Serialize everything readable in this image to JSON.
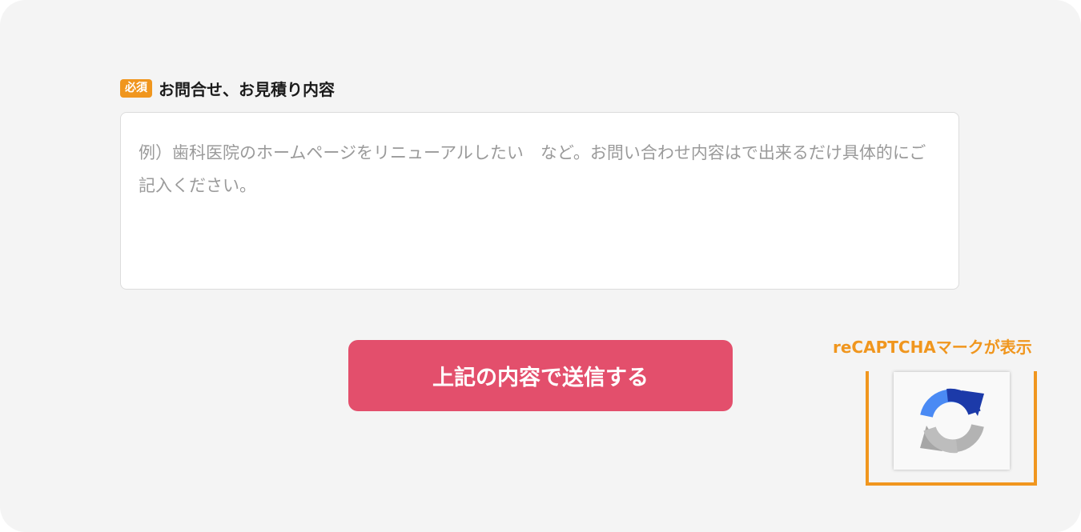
{
  "form": {
    "required_badge": "必須",
    "label": "お問合せ、お見積り内容",
    "placeholder": "例）歯科医院のホームページをリニューアルしたい　など。お問い合わせ内容はで出来るだけ具体的にご記入ください。",
    "value": ""
  },
  "submit": {
    "label": "上記の内容で送信する"
  },
  "recaptcha": {
    "note": "reCAPTCHAマークが表示",
    "icon": "recaptcha-icon"
  },
  "colors": {
    "accent": "#f0961e",
    "button": "#e34f6c",
    "background": "#f4f4f4"
  }
}
